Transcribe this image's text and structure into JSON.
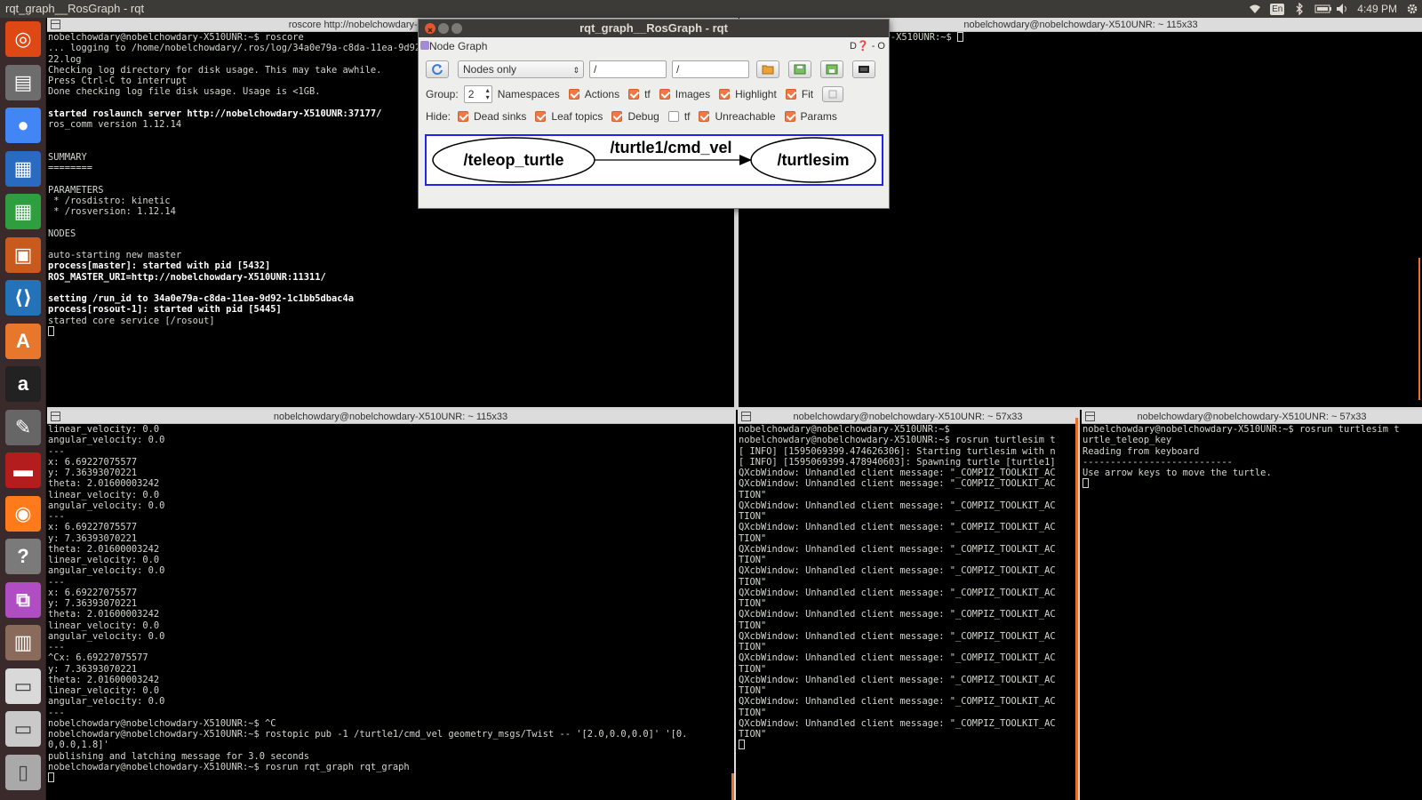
{
  "topbar": {
    "title": "rqt_graph__RosGraph - rqt",
    "keyboard": "En",
    "clock": "4:49 PM"
  },
  "launcher": [
    "ubuntu-dash-icon",
    "files-icon",
    "chrome-icon",
    "writer-icon",
    "calc-icon",
    "impress-icon",
    "vscode-icon",
    "software-center-icon",
    "amazon-icon",
    "settings-icon",
    "terminal-app-icon",
    "firefox-icon",
    "help-icon",
    "rqt-icon",
    "workspace-icon",
    "drive-icon",
    "drive2-icon",
    "trash-icon"
  ],
  "terminals": {
    "roscore": {
      "title": "roscore http://nobelchowdary-X510UNR:11311/",
      "lines": [
        {
          "t": "nobelchowdary@nobelchowdary-X510UNR:~$ roscore",
          "b": false
        },
        {
          "t": "... logging to /home/nobelchowdary/.ros/log/34a0e79a-c8da-11ea-9d92-1c1bb5dbac4a/roslaunch-nobelchowdary-X510UNR-54",
          "b": false
        },
        {
          "t": "22.log",
          "b": false
        },
        {
          "t": "Checking log directory for disk usage. This may take awhile.",
          "b": false
        },
        {
          "t": "Press Ctrl-C to interrupt",
          "b": false
        },
        {
          "t": "Done checking log file disk usage. Usage is <1GB.",
          "b": false
        },
        {
          "t": "",
          "b": false
        },
        {
          "t": "started roslaunch server http://nobelchowdary-X510UNR:37177/",
          "b": true
        },
        {
          "t": "ros_comm version 1.12.14",
          "b": false
        },
        {
          "t": "",
          "b": false
        },
        {
          "t": "",
          "b": false
        },
        {
          "t": "SUMMARY",
          "b": false
        },
        {
          "t": "========",
          "b": false
        },
        {
          "t": "",
          "b": false
        },
        {
          "t": "PARAMETERS",
          "b": false
        },
        {
          "t": " * /rosdistro: kinetic",
          "b": false
        },
        {
          "t": " * /rosversion: 1.12.14",
          "b": false
        },
        {
          "t": "",
          "b": false
        },
        {
          "t": "NODES",
          "b": false
        },
        {
          "t": "",
          "b": false
        },
        {
          "t": "auto-starting new master",
          "b": false
        },
        {
          "t": "process[master]: started with pid [5432]",
          "b": true
        },
        {
          "t": "ROS_MASTER_URI=http://nobelchowdary-X510UNR:11311/",
          "b": true
        },
        {
          "t": "",
          "b": false
        },
        {
          "t": "setting /run_id to 34a0e79a-c8da-11ea-9d92-1c1bb5dbac4a",
          "b": true
        },
        {
          "t": "process[rosout-1]: started with pid [5445]",
          "b": true
        },
        {
          "t": "started core service [/rosout]",
          "b": false
        }
      ]
    },
    "topright": {
      "title": "nobelchowdary@nobelchowdary-X510UNR: ~ 115x33",
      "lines": [
        {
          "t": "nobelchowdary@nobelchowdary-X510UNR:~$",
          "b": false
        }
      ]
    },
    "echo": {
      "title": "nobelchowdary@nobelchowdary-X510UNR: ~ 115x33",
      "lines": [
        {
          "t": "linear_velocity: 0.0",
          "b": false
        },
        {
          "t": "angular_velocity: 0.0",
          "b": false
        },
        {
          "t": "---",
          "b": false
        },
        {
          "t": "x: 6.69227075577",
          "b": false
        },
        {
          "t": "y: 7.36393070221",
          "b": false
        },
        {
          "t": "theta: 2.01600003242",
          "b": false
        },
        {
          "t": "linear_velocity: 0.0",
          "b": false
        },
        {
          "t": "angular_velocity: 0.0",
          "b": false
        },
        {
          "t": "---",
          "b": false
        },
        {
          "t": "x: 6.69227075577",
          "b": false
        },
        {
          "t": "y: 7.36393070221",
          "b": false
        },
        {
          "t": "theta: 2.01600003242",
          "b": false
        },
        {
          "t": "linear_velocity: 0.0",
          "b": false
        },
        {
          "t": "angular_velocity: 0.0",
          "b": false
        },
        {
          "t": "---",
          "b": false
        },
        {
          "t": "x: 6.69227075577",
          "b": false
        },
        {
          "t": "y: 7.36393070221",
          "b": false
        },
        {
          "t": "theta: 2.01600003242",
          "b": false
        },
        {
          "t": "linear_velocity: 0.0",
          "b": false
        },
        {
          "t": "angular_velocity: 0.0",
          "b": false
        },
        {
          "t": "---",
          "b": false
        },
        {
          "t": "^Cx: 6.69227075577",
          "b": false
        },
        {
          "t": "y: 7.36393070221",
          "b": false
        },
        {
          "t": "theta: 2.01600003242",
          "b": false
        },
        {
          "t": "linear_velocity: 0.0",
          "b": false
        },
        {
          "t": "angular_velocity: 0.0",
          "b": false
        },
        {
          "t": "---",
          "b": false
        },
        {
          "t": "nobelchowdary@nobelchowdary-X510UNR:~$ ^C",
          "b": false
        },
        {
          "t": "nobelchowdary@nobelchowdary-X510UNR:~$ rostopic pub -1 /turtle1/cmd_vel geometry_msgs/Twist -- '[2.0,0.0,0.0]' '[0.",
          "b": false
        },
        {
          "t": "0,0.0,1.8]'",
          "b": false
        },
        {
          "t": "publishing and latching message for 3.0 seconds",
          "b": false
        },
        {
          "t": "nobelchowdary@nobelchowdary-X510UNR:~$ rosrun rqt_graph rqt_graph",
          "b": false
        }
      ]
    },
    "turtlesim": {
      "title": "nobelchowdary@nobelchowdary-X510UNR: ~ 57x33",
      "lines": [
        {
          "t": "nobelchowdary@nobelchowdary-X510UNR:~$",
          "b": false
        },
        {
          "t": "nobelchowdary@nobelchowdary-X510UNR:~$ rosrun turtlesim t",
          "b": false
        },
        {
          "t": "[ INFO] [1595069399.474626306]: Starting turtlesim with n",
          "b": false
        },
        {
          "t": "[ INFO] [1595069399.478940603]: Spawning turtle [turtle1]",
          "b": false
        },
        {
          "t": "QXcbWindow: Unhandled client message: \"_COMPIZ_TOOLKIT_AC",
          "b": false
        },
        {
          "t": "QXcbWindow: Unhandled client message: \"_COMPIZ_TOOLKIT_AC",
          "b": false
        },
        {
          "t": "TION\"",
          "b": false
        },
        {
          "t": "QXcbWindow: Unhandled client message: \"_COMPIZ_TOOLKIT_AC",
          "b": false
        },
        {
          "t": "TION\"",
          "b": false
        },
        {
          "t": "QXcbWindow: Unhandled client message: \"_COMPIZ_TOOLKIT_AC",
          "b": false
        },
        {
          "t": "TION\"",
          "b": false
        },
        {
          "t": "QXcbWindow: Unhandled client message: \"_COMPIZ_TOOLKIT_AC",
          "b": false
        },
        {
          "t": "TION\"",
          "b": false
        },
        {
          "t": "QXcbWindow: Unhandled client message: \"_COMPIZ_TOOLKIT_AC",
          "b": false
        },
        {
          "t": "TION\"",
          "b": false
        },
        {
          "t": "QXcbWindow: Unhandled client message: \"_COMPIZ_TOOLKIT_AC",
          "b": false
        },
        {
          "t": "TION\"",
          "b": false
        },
        {
          "t": "QXcbWindow: Unhandled client message: \"_COMPIZ_TOOLKIT_AC",
          "b": false
        },
        {
          "t": "TION\"",
          "b": false
        },
        {
          "t": "QXcbWindow: Unhandled client message: \"_COMPIZ_TOOLKIT_AC",
          "b": false
        },
        {
          "t": "TION\"",
          "b": false
        },
        {
          "t": "QXcbWindow: Unhandled client message: \"_COMPIZ_TOOLKIT_AC",
          "b": false
        },
        {
          "t": "TION\"",
          "b": false
        },
        {
          "t": "QXcbWindow: Unhandled client message: \"_COMPIZ_TOOLKIT_AC",
          "b": false
        },
        {
          "t": "TION\"",
          "b": false
        },
        {
          "t": "QXcbWindow: Unhandled client message: \"_COMPIZ_TOOLKIT_AC",
          "b": false
        },
        {
          "t": "TION\"",
          "b": false
        },
        {
          "t": "QXcbWindow: Unhandled client message: \"_COMPIZ_TOOLKIT_AC",
          "b": false
        },
        {
          "t": "TION\"",
          "b": false
        }
      ]
    },
    "teleop": {
      "title": "nobelchowdary@nobelchowdary-X510UNR: ~ 57x33",
      "lines": [
        {
          "t": "nobelchowdary@nobelchowdary-X510UNR:~$ rosrun turtlesim t",
          "b": false
        },
        {
          "t": "urtle_teleop_key",
          "b": false
        },
        {
          "t": "Reading from keyboard",
          "b": false
        },
        {
          "t": "---------------------------",
          "b": false
        },
        {
          "t": "Use arrow keys to move the turtle.",
          "b": false
        }
      ]
    }
  },
  "rqt": {
    "title": "rqt_graph__RosGraph - rqt",
    "plugin_label": "Node Graph",
    "plugin_controls": "D❓ - O",
    "mode": "Nodes only",
    "filter1": "/",
    "filter2": "/",
    "group_label": "Group:",
    "group_value": "2",
    "row2": [
      {
        "label": "Namespaces",
        "checked": false,
        "has_box": false
      },
      {
        "label": "Actions",
        "checked": true
      },
      {
        "label": "tf",
        "checked": true
      },
      {
        "label": "Images",
        "checked": true
      },
      {
        "label": "Highlight",
        "checked": true
      },
      {
        "label": "Fit",
        "checked": true
      }
    ],
    "hide_label": "Hide:",
    "row3": [
      {
        "label": "Dead sinks",
        "checked": true
      },
      {
        "label": "Leaf topics",
        "checked": true
      },
      {
        "label": "Debug",
        "checked": true
      },
      {
        "label": "tf",
        "checked": false
      },
      {
        "label": "Unreachable",
        "checked": true
      },
      {
        "label": "Params",
        "checked": true
      }
    ],
    "graph": {
      "node_left": "/teleop_turtle",
      "node_right": "/turtlesim",
      "edge": "/turtle1/cmd_vel"
    }
  }
}
